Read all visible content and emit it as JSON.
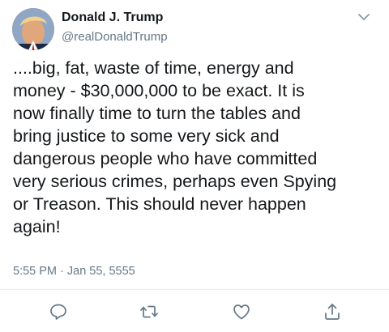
{
  "tweet": {
    "display_name": "Donald J. Trump",
    "handle": "@realDonaldTrump",
    "text": "....big, fat, waste of time, energy and\nmoney - $30,000,000 to be exact. It is\nnow finally time to turn the tables and\nbring justice to some very sick and\ndangerous people who have committed\nvery serious crimes, perhaps even Spying\nor Treason. This should never happen\nagain!",
    "timestamp": "5:55 PM · Jan 55, 5555"
  },
  "icons": {
    "menu": "chevron-down-icon",
    "reply": "reply-icon",
    "retweet": "retweet-icon",
    "like": "heart-icon",
    "share": "share-icon"
  },
  "colors": {
    "text_primary": "#14171a",
    "text_secondary": "#657786",
    "icon": "#657786",
    "divider": "#e6ecf0"
  }
}
